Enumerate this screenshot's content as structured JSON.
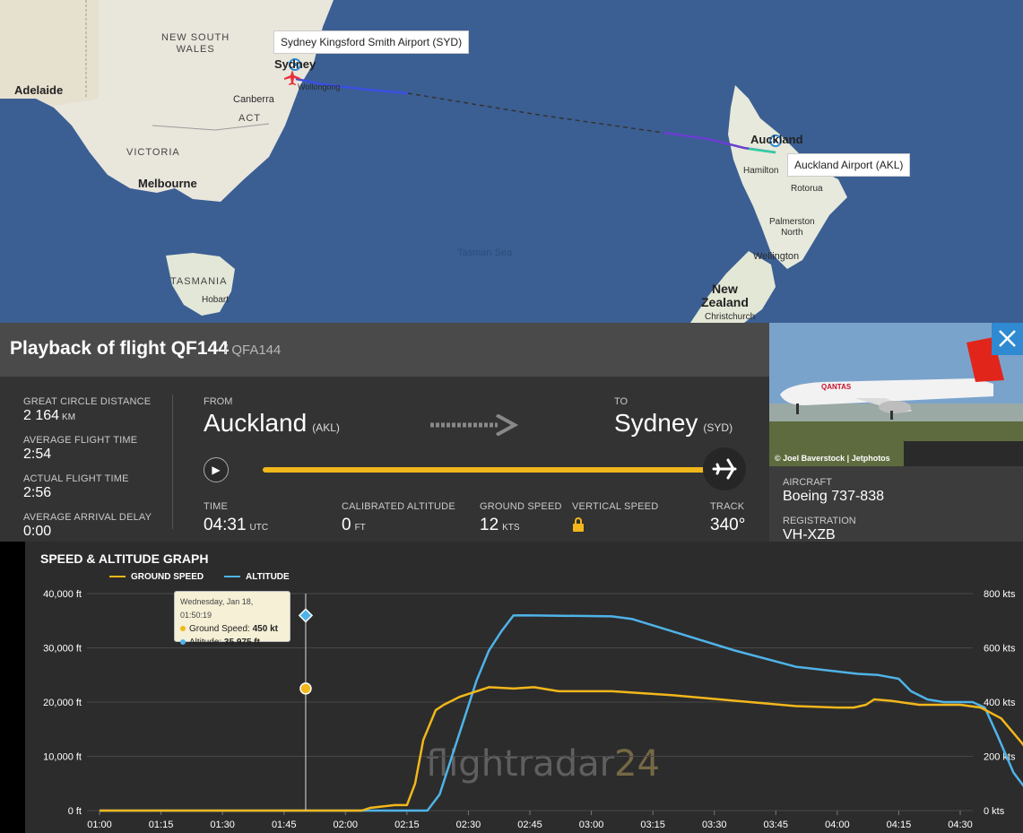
{
  "map": {
    "labels": {
      "new_south_wales": "NEW SOUTH\nWALES",
      "adelaide": "Adelaide",
      "sydney": "Sydney",
      "wollongong": "Wollongong",
      "canberra": "Canberra",
      "act": "ACT",
      "victoria": "VICTORIA",
      "melbourne": "Melbourne",
      "tasmania": "TASMANIA",
      "hobart": "Hobart",
      "tasman_sea": "Tasman Sea",
      "auckland": "Auckland",
      "hamilton": "Hamilton",
      "rotorua": "Rotorua",
      "palmerston_north": "Palmerston\nNorth",
      "wellington": "Wellington",
      "new_zealand": "New\nZealand",
      "christchurch": "Christchurch"
    },
    "syd_popup": "Sydney Kingsford Smith Airport (SYD)",
    "akl_popup": "Auckland Airport (AKL)"
  },
  "header": {
    "title": "Playback of flight QF144",
    "subtitle": "/ QFA144"
  },
  "stats": {
    "gcd_label": "GREAT CIRCLE DISTANCE",
    "gcd_value": "2 164",
    "gcd_unit": "KM",
    "aft_label": "AVERAGE FLIGHT TIME",
    "aft_value": "2:54",
    "act_label": "ACTUAL FLIGHT TIME",
    "act_value": "2:56",
    "aad_label": "AVERAGE ARRIVAL DELAY",
    "aad_value": "0:00"
  },
  "route": {
    "from_label": "FROM",
    "from_city": "Auckland",
    "from_code": "(AKL)",
    "to_label": "TO",
    "to_city": "Sydney",
    "to_code": "(SYD)",
    "progress": 1.0
  },
  "telemetry": {
    "time_label": "TIME",
    "time_value": "04:31",
    "time_unit": "UTC",
    "alt_label": "CALIBRATED ALTITUDE",
    "alt_value": "0",
    "alt_unit": "FT",
    "gs_label": "GROUND SPEED",
    "gs_value": "12",
    "gs_unit": "KTS",
    "vs_label": "VERTICAL SPEED",
    "track_label": "TRACK",
    "track_value": "340°"
  },
  "aircraft": {
    "photo_credit": "© Joel Baverstock | Jetphotos",
    "type_label": "AIRCRAFT",
    "type_value": "Boeing 737-838",
    "reg_label": "REGISTRATION",
    "reg_value": "VH-XZB"
  },
  "colors": {
    "ground_speed": "#f2b71b",
    "altitude": "#4fb3e8",
    "accent": "#2f8ad1"
  },
  "graph": {
    "title": "SPEED & ALTITUDE GRAPH",
    "legend_gs": "GROUND SPEED",
    "legend_alt": "ALTITUDE",
    "tooltip_date": "Wednesday, Jan 18, 01:50:19",
    "tooltip_gs_label": "Ground Speed:",
    "tooltip_gs_value": "450 kt",
    "tooltip_alt_label": "Altitude:",
    "tooltip_alt_value": "35 975 ft",
    "watermark_a": "flightradar",
    "watermark_b": "24"
  },
  "chart_data": {
    "type": "line",
    "title": "SPEED & ALTITUDE GRAPH",
    "x_ticks": [
      "01:00",
      "01:15",
      "01:30",
      "01:45",
      "02:00",
      "02:15",
      "02:30",
      "02:45",
      "03:00",
      "03:15",
      "03:30",
      "03:45",
      "04:00",
      "04:15",
      "04:30"
    ],
    "y_left_ticks": [
      "0 ft",
      "10,000 ft",
      "20,000 ft",
      "30,000 ft",
      "40,000 ft"
    ],
    "y_right_ticks": [
      "0 kts",
      "200 kts",
      "400 kts",
      "600 kts",
      "800 kts"
    ],
    "ylim_left": [
      0,
      40000
    ],
    "ylim_right": [
      0,
      800
    ],
    "xlim_minutes": [
      0,
      212
    ],
    "series": [
      {
        "name": "ALTITUDE",
        "axis": "left",
        "points": [
          [
            0,
            0
          ],
          [
            78,
            0
          ],
          [
            80,
            0
          ],
          [
            83,
            3000
          ],
          [
            86,
            10000
          ],
          [
            89,
            17000
          ],
          [
            92,
            24000
          ],
          [
            95,
            29500
          ],
          [
            98,
            33000
          ],
          [
            101,
            35975
          ],
          [
            104,
            36000
          ],
          [
            125,
            35800
          ],
          [
            130,
            35300
          ],
          [
            140,
            33000
          ],
          [
            155,
            29500
          ],
          [
            170,
            26500
          ],
          [
            185,
            25200
          ],
          [
            190,
            25000
          ],
          [
            195,
            24300
          ],
          [
            198,
            22000
          ],
          [
            202,
            20500
          ],
          [
            206,
            20000
          ],
          [
            213,
            20000
          ],
          [
            216,
            19000
          ],
          [
            219,
            14000
          ],
          [
            223,
            7000
          ],
          [
            227,
            3000
          ],
          [
            230,
            1000
          ],
          [
            233,
            0
          ],
          [
            237,
            0
          ]
        ]
      },
      {
        "name": "GROUND SPEED",
        "axis": "right",
        "points": [
          [
            0,
            0
          ],
          [
            64,
            0
          ],
          [
            66,
            10
          ],
          [
            72,
            20
          ],
          [
            75,
            20
          ],
          [
            77,
            100
          ],
          [
            79,
            260
          ],
          [
            82,
            370
          ],
          [
            84,
            390
          ],
          [
            88,
            420
          ],
          [
            95,
            455
          ],
          [
            101,
            450
          ],
          [
            106,
            455
          ],
          [
            112,
            440
          ],
          [
            125,
            440
          ],
          [
            140,
            425
          ],
          [
            155,
            405
          ],
          [
            170,
            385
          ],
          [
            180,
            380
          ],
          [
            184,
            380
          ],
          [
            187,
            390
          ],
          [
            189,
            410
          ],
          [
            193,
            405
          ],
          [
            200,
            390
          ],
          [
            210,
            390
          ],
          [
            215,
            380
          ],
          [
            220,
            340
          ],
          [
            225,
            250
          ],
          [
            229,
            170
          ],
          [
            232,
            150
          ],
          [
            234,
            40
          ],
          [
            236,
            20
          ],
          [
            237,
            10
          ]
        ]
      }
    ]
  }
}
